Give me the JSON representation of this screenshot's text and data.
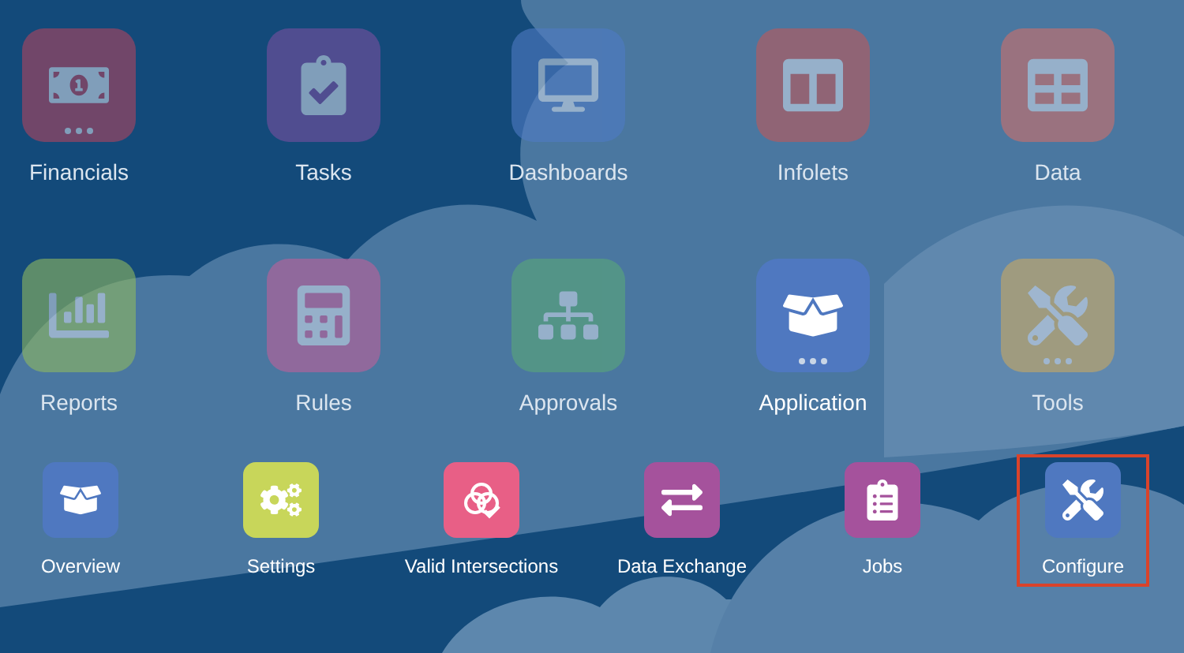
{
  "main_tiles": [
    {
      "label": "Financials",
      "selected": false,
      "more": true
    },
    {
      "label": "Tasks",
      "selected": false,
      "more": false
    },
    {
      "label": "Dashboards",
      "selected": false,
      "more": false
    },
    {
      "label": "Infolets",
      "selected": false,
      "more": false
    },
    {
      "label": "Data",
      "selected": false,
      "more": false
    },
    {
      "label": "Reports",
      "selected": false,
      "more": false
    },
    {
      "label": "Rules",
      "selected": false,
      "more": false
    },
    {
      "label": "Approvals",
      "selected": false,
      "more": false
    },
    {
      "label": "Application",
      "selected": true,
      "more": true
    },
    {
      "label": "Tools",
      "selected": false,
      "more": true
    }
  ],
  "sub_tiles": [
    {
      "label": "Overview",
      "selected": false
    },
    {
      "label": "Settings",
      "selected": false
    },
    {
      "label": "Valid Intersections",
      "selected": false
    },
    {
      "label": "Data Exchange",
      "selected": false
    },
    {
      "label": "Jobs",
      "selected": false
    },
    {
      "label": "Configure",
      "selected": true
    }
  ]
}
